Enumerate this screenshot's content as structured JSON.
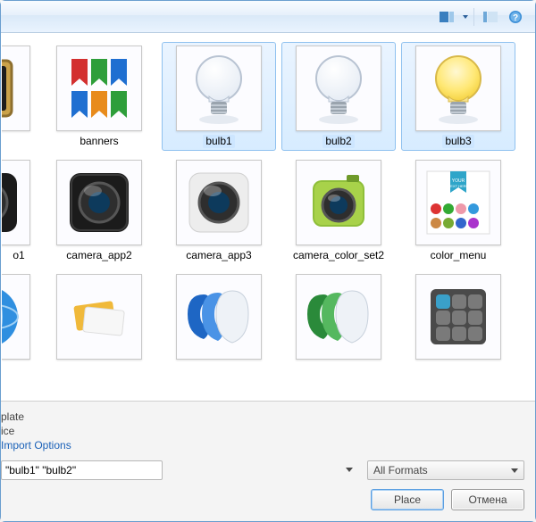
{
  "toolbar": {
    "preview_icon": "preview",
    "split_icon": "split-view",
    "help_icon": "help"
  },
  "files": {
    "row1": [
      {
        "name": "",
        "kind": "gold-card",
        "partial": true
      },
      {
        "name": "banners",
        "kind": "banners"
      },
      {
        "name": "bulb1",
        "kind": "bulb",
        "lit": false,
        "selected": true
      },
      {
        "name": "bulb2",
        "kind": "bulb",
        "lit": false,
        "selected": true
      },
      {
        "name": "bulb3",
        "kind": "bulb",
        "lit": true,
        "selected": true
      }
    ],
    "row2": [
      {
        "name": "o1",
        "kind": "camera-gloss",
        "dark": true,
        "partial": true,
        "caption": "o1"
      },
      {
        "name": "camera_app2",
        "kind": "camera-gloss",
        "dark": true
      },
      {
        "name": "camera_app3",
        "kind": "camera-gloss",
        "dark": false
      },
      {
        "name": "camera_color_set2",
        "kind": "camera-color",
        "caption": "camera_color_set2"
      },
      {
        "name": "color_menu",
        "kind": "color-menu"
      }
    ],
    "row3": [
      {
        "name": "",
        "kind": "globe",
        "partial": true
      },
      {
        "name": "",
        "kind": "cards"
      },
      {
        "name": "",
        "kind": "heads-blue"
      },
      {
        "name": "",
        "kind": "heads-green"
      },
      {
        "name": "",
        "kind": "tiles"
      }
    ]
  },
  "options": {
    "line1": "plate",
    "line2": "ice",
    "import_link": "Import Options"
  },
  "filename_value": "\"bulb1\" \"bulb2\"",
  "format_value": "All Formats",
  "buttons": {
    "place": "Place",
    "cancel": "Отмена"
  }
}
